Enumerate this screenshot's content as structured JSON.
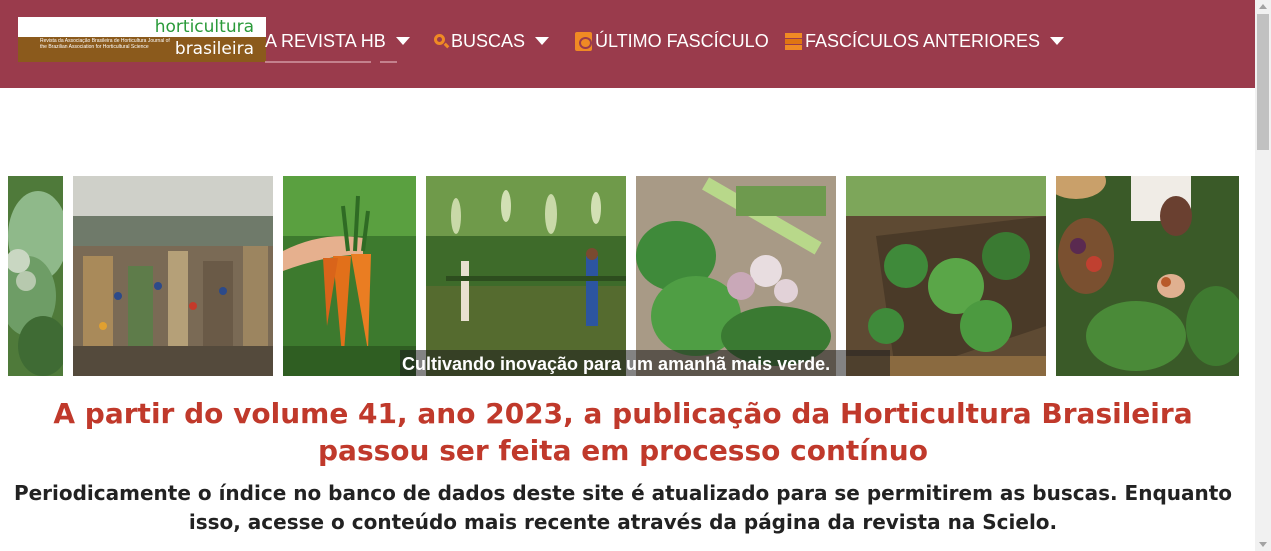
{
  "header": {
    "logo": {
      "word1": "horticultura",
      "word2": "brasileira",
      "small_text": "Revista da Associação Brasileira de Horticultura Journal of the Brazilian Association for Horticultural Science"
    },
    "nav": [
      {
        "label": "A REVISTA HB",
        "has_dropdown": true,
        "icon": null
      },
      {
        "label": "BUSCAS",
        "has_dropdown": true,
        "icon": "search-icon"
      },
      {
        "label": "ÚLTIMO FASCÍCULO",
        "has_dropdown": false,
        "icon": "document-icon"
      },
      {
        "label": "FASCÍCULOS ANTERIORES",
        "has_dropdown": true,
        "icon": "books-icon"
      }
    ]
  },
  "carousel": {
    "caption": "Cultivando inovação para um amanhã mais verde.",
    "photos": [
      "cabbage",
      "market-hall",
      "carrots-in-hand",
      "gourd-arbor",
      "herbs-and-garlic",
      "raised-bed-garden",
      "harvest-basket"
    ]
  },
  "main": {
    "headline": "A partir do volume 41, ano 2023, a publicação da Horticultura Brasileira passou ser feita em processo contínuo",
    "subtext": "Periodicamente o índice no banco de dados deste site é atualizado para se permitirem as buscas. Enquanto isso, acesse o conteúdo mais recente através da página da revista na Scielo."
  },
  "colors": {
    "header_bg": "#9a3b4c",
    "accent_orange": "#f08a24",
    "headline_red": "#c0392b"
  }
}
